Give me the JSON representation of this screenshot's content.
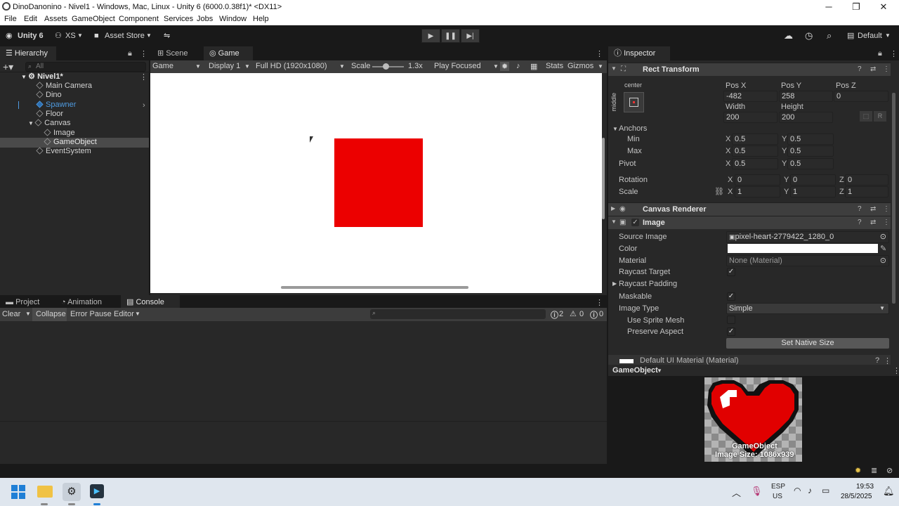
{
  "window": {
    "title": "DinoDanonino - Nivel1 - Windows, Mac, Linux - Unity 6 (6000.0.38f1)* <DX11>",
    "minimize": "─",
    "maximize": "❐",
    "close": "✕"
  },
  "menu": [
    "File",
    "Edit",
    "Assets",
    "GameObject",
    "Component",
    "Services",
    "Jobs",
    "Window",
    "Help"
  ],
  "toolbar": {
    "unity": "Unity 6",
    "account": "XS",
    "asset_store": "Asset Store",
    "layout": "Default"
  },
  "hierarchy": {
    "tab": "Hierarchy",
    "search_placeholder": "All",
    "items": [
      {
        "label": "Nivel1*",
        "indent": 0
      },
      {
        "label": "Main Camera",
        "indent": 1
      },
      {
        "label": "Dino",
        "indent": 1
      },
      {
        "label": "Spawner",
        "indent": 1
      },
      {
        "label": "Floor",
        "indent": 1
      },
      {
        "label": "Canvas",
        "indent": 1
      },
      {
        "label": "Image",
        "indent": 2
      },
      {
        "label": "GameObject",
        "indent": 2
      },
      {
        "label": "EventSystem",
        "indent": 1
      }
    ]
  },
  "scene_tabs": {
    "scene": "Scene",
    "game": "Game"
  },
  "game_bar": {
    "mode": "Game",
    "display": "Display 1",
    "resolution": "Full HD (1920x1080)",
    "scale_label": "Scale",
    "scale_value": "1.3x",
    "play_focused": "Play Focused",
    "stats": "Stats",
    "gizmos": "Gizmos"
  },
  "bottom_tabs": {
    "project": "Project",
    "animation": "Animation",
    "console": "Console"
  },
  "console": {
    "clear": "Clear",
    "collapse": "Collapse",
    "error_pause": "Error Pause",
    "editor": "Editor",
    "info_count": "2",
    "warn_count": "0",
    "err_count": "0"
  },
  "inspector": {
    "tab": "Inspector",
    "rect": {
      "title": "Rect Transform",
      "anchor_preset": "center",
      "anchor_side": "middle",
      "pos_x_label": "Pos X",
      "pos_y_label": "Pos Y",
      "pos_z_label": "Pos Z",
      "pos_x": "-482",
      "pos_y": "258",
      "pos_z": "0",
      "width_label": "Width",
      "height_label": "Height",
      "width": "200",
      "height": "200",
      "r": "R",
      "anchors": "Anchors",
      "min": "Min",
      "max": "Max",
      "pivot": "Pivot",
      "rotation": "Rotation",
      "scale": "Scale",
      "x": "X",
      "y": "Y",
      "z": "Z",
      "min_x": "0.5",
      "min_y": "0.5",
      "max_x": "0.5",
      "max_y": "0.5",
      "pivot_x": "0.5",
      "pivot_y": "0.5",
      "rot_x": "0",
      "rot_y": "0",
      "rot_z": "0",
      "scale_x": "1",
      "scale_y": "1",
      "scale_z": "1"
    },
    "canvas_renderer": {
      "title": "Canvas Renderer"
    },
    "image": {
      "title": "Image",
      "source_label": "Source Image",
      "source": "pixel-heart-2779422_1280_0",
      "color_label": "Color",
      "material_label": "Material",
      "material": "None (Material)",
      "raycast_target": "Raycast Target",
      "raycast_padding": "Raycast Padding",
      "maskable": "Maskable",
      "image_type_label": "Image Type",
      "image_type": "Simple",
      "use_sprite_mesh": "Use Sprite Mesh",
      "preserve_aspect": "Preserve Aspect",
      "set_native": "Set Native Size"
    },
    "material_hdr": "Default UI Material (Material)",
    "preview": {
      "header": "GameObject",
      "name": "GameObject",
      "size": "Image Size: 1086x939"
    }
  },
  "taskbar": {
    "lang1": "ESP",
    "lang2": "US",
    "time": "19:53",
    "date": "28/5/2025"
  },
  "colors": {
    "red_square": "#ec0000",
    "accent": "#3a79bb",
    "spawner": "#4f9be0"
  }
}
